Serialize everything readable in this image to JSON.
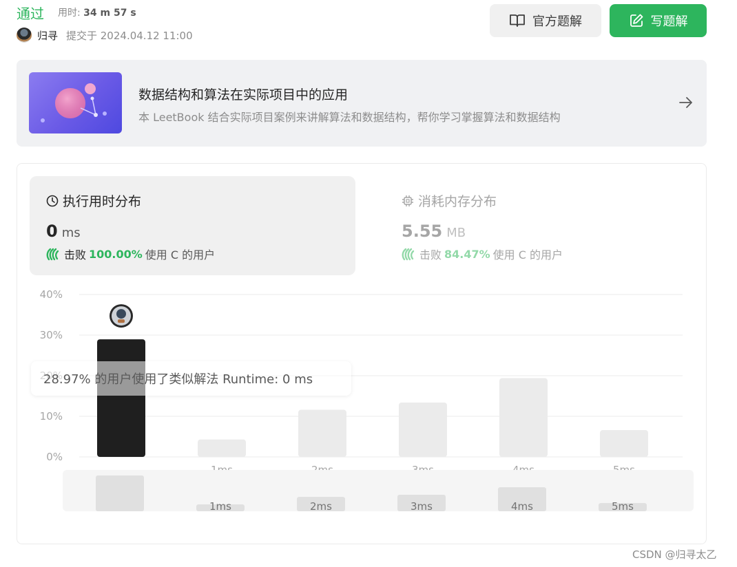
{
  "header": {
    "status": "通过",
    "time_label": "用时: ",
    "time_value": "34 m 57 s",
    "username": "归寻",
    "submit_info": "提交于 2024.04.12 11:00",
    "btn_official": "官方题解",
    "btn_write": "写题解"
  },
  "banner": {
    "title": "数据结构和算法在实际项目中的应用",
    "description": "本 LeetBook 结合实际项目案例来讲解算法和数据结构，帮你学习掌握算法和数据结构"
  },
  "runtime": {
    "title": "执行用时分布",
    "value": "0",
    "unit": "ms",
    "beats_label": "击败",
    "beats_pct": "100.00%",
    "beats_suffix": "使用 C 的用户"
  },
  "memory": {
    "title": "消耗内存分布",
    "value": "5.55",
    "unit": "MB",
    "beats_label": "击败",
    "beats_pct": "84.47%",
    "beats_suffix": "使用 C 的用户"
  },
  "tooltip": "28.97% 的用户使用了类似解法 Runtime: 0 ms",
  "colors": {
    "accent": "#2db55d",
    "bar_active": "#1f1f1f",
    "bar_inactive": "#ebebeb"
  },
  "chart_data": {
    "type": "bar",
    "categories": [
      "",
      "1ms",
      "2ms",
      "3ms",
      "4ms",
      "5ms"
    ],
    "values": [
      28.97,
      4.3,
      11.6,
      13.4,
      19.4,
      6.6
    ],
    "y_ticks": [
      "0%",
      "10%",
      "20%",
      "30%",
      "40%"
    ],
    "ylim": [
      0,
      40
    ],
    "active_index": 0,
    "grid": true
  },
  "overview": {
    "categories": [
      "",
      "1ms",
      "2ms",
      "3ms",
      "4ms",
      "5ms"
    ],
    "values": [
      28.97,
      4.3,
      11.6,
      13.4,
      19.4,
      6.6
    ]
  },
  "watermark": "CSDN @归寻太乙"
}
